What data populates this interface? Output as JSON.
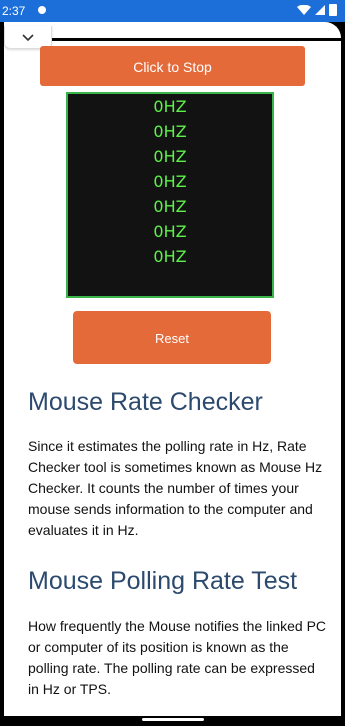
{
  "status": {
    "time": "2:37"
  },
  "controls": {
    "stop_label": "Click to Stop",
    "reset_label": "Reset"
  },
  "readings": [
    "0HZ",
    "0HZ",
    "0HZ",
    "0HZ",
    "0HZ",
    "0HZ",
    "0HZ"
  ],
  "content": {
    "heading1": "Mouse Rate Checker",
    "para1": "Since it estimates the polling rate in Hz, Rate Checker tool is sometimes known as Mouse Hz Checker. It counts the number of times your mouse sends information to the computer and evaluates it in Hz.",
    "heading2": "Mouse Polling Rate Test",
    "para2": "How frequently the Mouse notifies the linked PC or computer of its position is known as the polling rate. The polling rate can be expressed in Hz or TPS."
  },
  "colors": {
    "accent": "#e46a3a",
    "heading": "#2c4a6e",
    "display_text": "#5ef24a",
    "display_border": "#39b54a",
    "statusbar": "#1c6fd8"
  },
  "icons": {
    "dropdown": "chevron-down-icon"
  }
}
